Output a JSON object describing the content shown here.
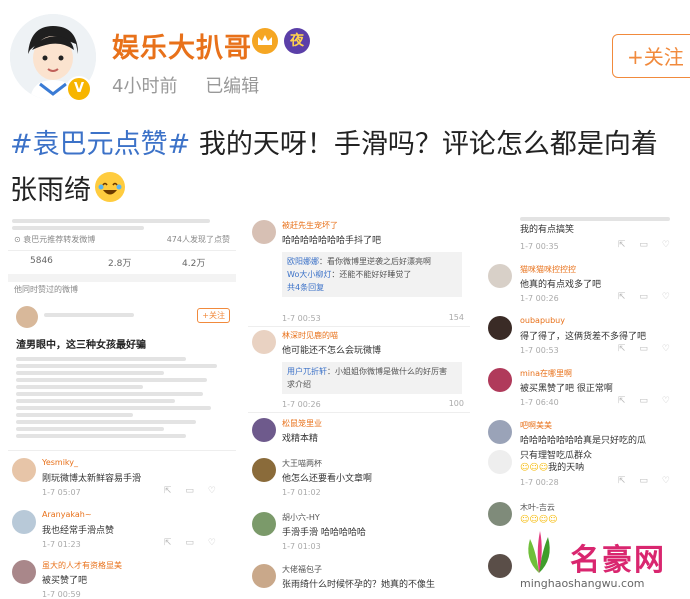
{
  "post": {
    "username": "娱乐大扒哥",
    "night_badge": "夜",
    "time": "4小时前",
    "edited": "已编辑",
    "follow_label": "+关注",
    "hashtag": "#袁巴元点赞#",
    "text": " 我的天呀！手滑吗？评论怎么都是向着",
    "text2": "张雨绮"
  },
  "panel1": {
    "ref": "⊙ 袁巴元推荐转发微博",
    "ref_stat": "474人发现了点赞",
    "stats": [
      "5846",
      "2.8万",
      "4.2万"
    ],
    "section_title": "他同时赞过的微博",
    "follow_small": "+关注",
    "headline": "渣男眼中，这三种女孩最好骗",
    "comments": [
      {
        "name": "Yesmiky_",
        "text": "刚玩微博太新鲜容易手滑",
        "time": "1-7 05:07"
      },
      {
        "name": "Aranyakah~",
        "text": "我也经常手滑点赞",
        "time": "1-7 01:23"
      },
      {
        "name": "虽大的人才有资格显美",
        "text": "被买赞了吧",
        "time": "1-7 00:59"
      }
    ]
  },
  "panel2": {
    "comments": [
      {
        "name": "被赶先生宠坏了",
        "text": "哈哈哈哈哈哈哈手抖了吧",
        "time": "1-7 00:53",
        "likes": "154",
        "replies": [
          {
            "name": "欧阳娜娜",
            "text": "：看你微博里逆袭之后好漂亮啊"
          },
          {
            "name": "Wo大小柳灯",
            "text": "：还能不能好好睡觉了"
          }
        ],
        "more": "共4条回复"
      },
      {
        "name": "林深时见鹿的喵",
        "text": "他可能还不怎么会玩微博",
        "time": "1-7 00:26",
        "likes": "100",
        "replies": [
          {
            "name": "用户兀折轩",
            "text": "：小姐姐你微博是做什么的好厉害 求介绍"
          }
        ]
      },
      {
        "name": "松鼠笼里业",
        "text": "戏精本精",
        "time": ""
      },
      {
        "name": "大王喵两杯",
        "text": "他怎么还要看小文章啊",
        "time": "1-7 01:02"
      },
      {
        "name": "胡小六-HY",
        "text": "手滑手滑 哈哈哈哈哈",
        "time": "1-7 01:03"
      },
      {
        "name": "大佬福包子",
        "text": "张雨绮什么时候怀孕的？她真的不像生",
        "time": ""
      }
    ]
  },
  "panel3": {
    "top_text": "我的有点搞笑",
    "comments": [
      {
        "name": "",
        "text": "",
        "time": "1-7 00:35"
      },
      {
        "name": "猫咪猫咪控控控",
        "text": "他真的有点戏多了吧",
        "time": "1-7 00:26"
      },
      {
        "name": "oubapubuy",
        "text": "得了得了，这俩货差不多得了吧",
        "time": "1-7 00:53"
      },
      {
        "name": "mina在哪里啊",
        "text": "被买黑赞了吧 很正常啊",
        "time": "1-7 06:40"
      },
      {
        "name": "吧啊美美",
        "text": "哈哈哈哈哈哈哈真是只好吃的瓜",
        "time": ""
      },
      {
        "name": "",
        "text": "只有理智吃瓜群众",
        "time": ""
      },
      {
        "name": "",
        "text": "我的天呐",
        "time": "1-7 00:28"
      },
      {
        "name": "木叶-吉云",
        "text": "",
        "time": ""
      }
    ]
  },
  "watermark": {
    "brand": "名豪网",
    "url": "minghaoshangwu.com"
  }
}
